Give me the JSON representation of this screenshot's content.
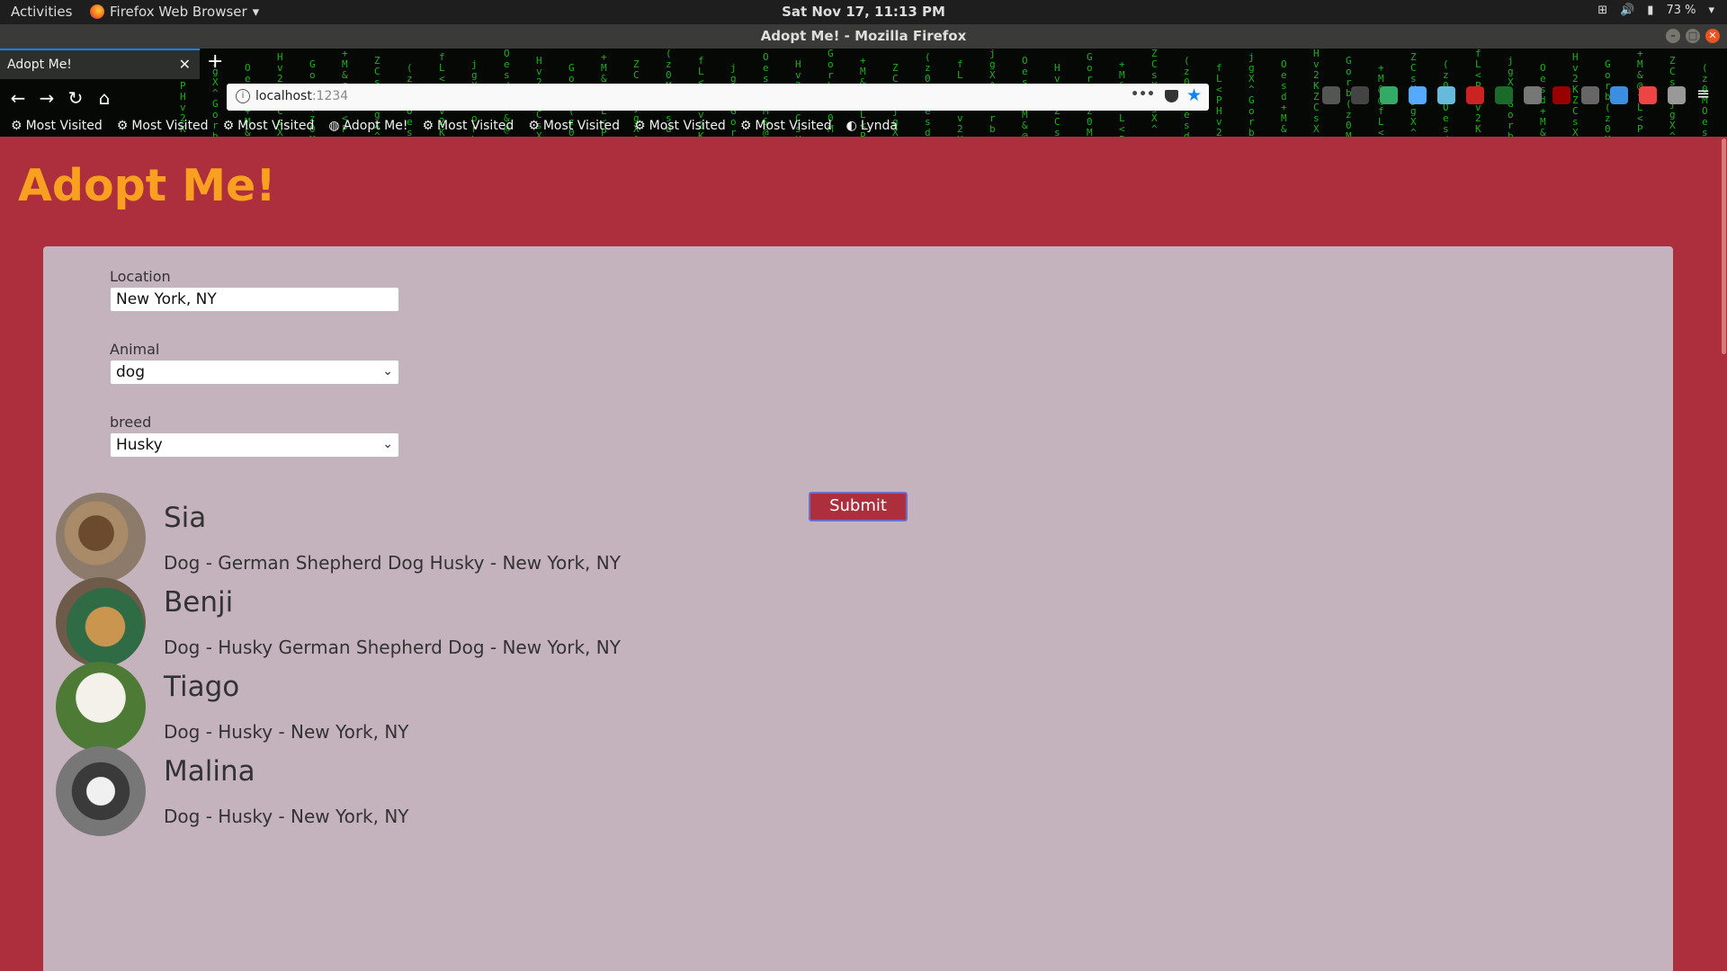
{
  "system": {
    "activities": "Activities",
    "app_name": "Firefox Web Browser",
    "clock": "Sat Nov 17, 11:13 PM",
    "battery": "73 %"
  },
  "window": {
    "title": "Adopt Me! - Mozilla Firefox"
  },
  "browser": {
    "tab_title": "Adopt Me!",
    "url_host": "localhost",
    "url_port": ":1234",
    "bookmarks": [
      "Most Visited",
      "Most Visited",
      "Most Visited",
      "Adopt Me!",
      "Most Visited",
      "Most Visited",
      "Most Visited",
      "Most Visited",
      "Lynda"
    ]
  },
  "page": {
    "heading": "Adopt Me!",
    "form": {
      "location_label": "Location",
      "location_value": "New York, NY",
      "animal_label": "Animal",
      "animal_value": "dog",
      "breed_label": "breed",
      "breed_value": "Husky",
      "submit_label": "Submit"
    },
    "pets": [
      {
        "name": "Sia",
        "desc": "Dog - German Shepherd Dog Husky - New York, NY"
      },
      {
        "name": "Benji",
        "desc": "Dog - Husky German Shepherd Dog - New York, NY"
      },
      {
        "name": "Tiago",
        "desc": "Dog - Husky - New York, NY"
      },
      {
        "name": "Malina",
        "desc": "Dog - Husky - New York, NY"
      }
    ]
  },
  "colors": {
    "page_bg": "#ad2f3e",
    "card_bg": "#c4b2bd",
    "heading": "#f9a020"
  }
}
